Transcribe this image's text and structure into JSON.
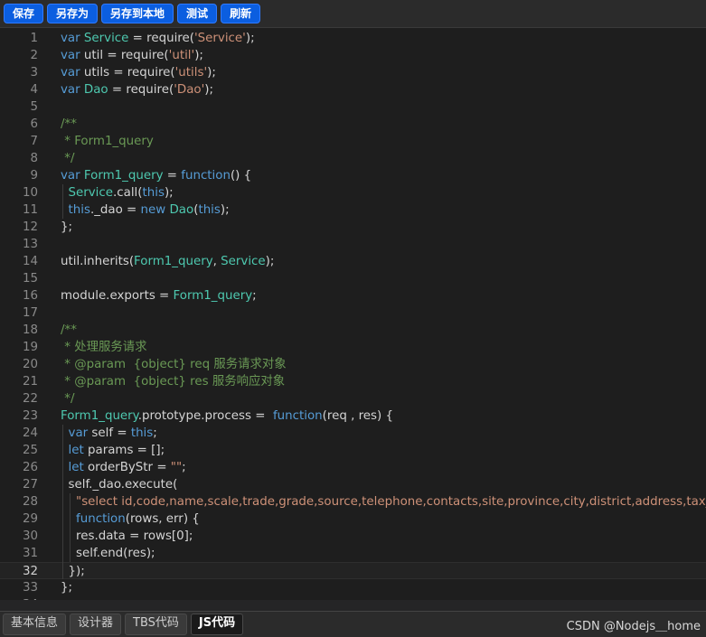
{
  "toolbar": {
    "buttons": [
      "保存",
      "另存为",
      "另存到本地",
      "测试",
      "刷新"
    ]
  },
  "editor": {
    "current_line": 32,
    "lines": [
      [
        [
          "kw",
          "var "
        ],
        [
          "cls",
          "Service"
        ],
        [
          "def",
          " = require("
        ],
        [
          "str",
          "'Service'"
        ],
        [
          "def",
          ");"
        ]
      ],
      [
        [
          "kw",
          "var "
        ],
        [
          "def",
          "util = require("
        ],
        [
          "str",
          "'util'"
        ],
        [
          "def",
          ");"
        ]
      ],
      [
        [
          "kw",
          "var "
        ],
        [
          "def",
          "utils = require("
        ],
        [
          "str",
          "'utils'"
        ],
        [
          "def",
          ");"
        ]
      ],
      [
        [
          "kw",
          "var "
        ],
        [
          "cls",
          "Dao"
        ],
        [
          "def",
          " = require("
        ],
        [
          "str",
          "'Dao'"
        ],
        [
          "def",
          ");"
        ]
      ],
      [],
      [
        [
          "cm",
          "/**"
        ]
      ],
      [
        [
          "cm",
          " * Form1_query"
        ]
      ],
      [
        [
          "cm",
          " */"
        ]
      ],
      [
        [
          "kw",
          "var "
        ],
        [
          "cls",
          "Form1_query"
        ],
        [
          "def",
          " = "
        ],
        [
          "kw",
          "function"
        ],
        [
          "def",
          "() {"
        ]
      ],
      [
        [
          "def",
          "  "
        ],
        [
          "cls",
          "Service"
        ],
        [
          "def",
          ".call("
        ],
        [
          "kw",
          "this"
        ],
        [
          "def",
          ");"
        ]
      ],
      [
        [
          "def",
          "  "
        ],
        [
          "kw",
          "this"
        ],
        [
          "def",
          "._dao = "
        ],
        [
          "kw",
          "new "
        ],
        [
          "cls",
          "Dao"
        ],
        [
          "def",
          "("
        ],
        [
          "kw",
          "this"
        ],
        [
          "def",
          ");"
        ]
      ],
      [
        [
          "def",
          "};"
        ]
      ],
      [],
      [
        [
          "def",
          "util.inherits("
        ],
        [
          "cls",
          "Form1_query"
        ],
        [
          "def",
          ", "
        ],
        [
          "cls",
          "Service"
        ],
        [
          "def",
          ");"
        ]
      ],
      [],
      [
        [
          "def",
          "module.exports = "
        ],
        [
          "cls",
          "Form1_query"
        ],
        [
          "def",
          ";"
        ]
      ],
      [],
      [
        [
          "cm",
          "/**"
        ]
      ],
      [
        [
          "cm",
          " * 处理服务请求"
        ]
      ],
      [
        [
          "cm",
          " * @param  {object} req 服务请求对象"
        ]
      ],
      [
        [
          "cm",
          " * @param  {object} res 服务响应对象"
        ]
      ],
      [
        [
          "cm",
          " */"
        ]
      ],
      [
        [
          "cls",
          "Form1_query"
        ],
        [
          "def",
          ".prototype.process =  "
        ],
        [
          "kw",
          "function"
        ],
        [
          "def",
          "(req , res) {"
        ]
      ],
      [
        [
          "def",
          "  "
        ],
        [
          "kw",
          "var "
        ],
        [
          "def",
          "self = "
        ],
        [
          "kw",
          "this"
        ],
        [
          "def",
          ";"
        ]
      ],
      [
        [
          "def",
          "  "
        ],
        [
          "kw",
          "let "
        ],
        [
          "def",
          "params = [];"
        ]
      ],
      [
        [
          "def",
          "  "
        ],
        [
          "kw",
          "let "
        ],
        [
          "def",
          "orderByStr = "
        ],
        [
          "str",
          "\"\""
        ],
        [
          "def",
          ";"
        ]
      ],
      [
        [
          "def",
          "  self._dao.execute("
        ]
      ],
      [
        [
          "def",
          "    "
        ],
        [
          "str",
          "\"select id,code,name,scale,trade,grade,source,telephone,contacts,site,province,city,district,address,tax_nu"
        ]
      ],
      [
        [
          "def",
          "    "
        ],
        [
          "kw",
          "function"
        ],
        [
          "def",
          "(rows, err) {"
        ]
      ],
      [
        [
          "def",
          "    res.data = rows[0];"
        ]
      ],
      [
        [
          "def",
          "    self.end(res);"
        ]
      ],
      [
        [
          "def",
          "  });"
        ]
      ],
      [
        [
          "def",
          "};"
        ]
      ],
      []
    ]
  },
  "tabs": [
    {
      "label": "基本信息",
      "active": false
    },
    {
      "label": "设计器",
      "active": false
    },
    {
      "label": "TBS代码",
      "active": false
    },
    {
      "label": "JS代码",
      "active": true
    }
  ],
  "watermark": "CSDN @Nodejs＿home"
}
